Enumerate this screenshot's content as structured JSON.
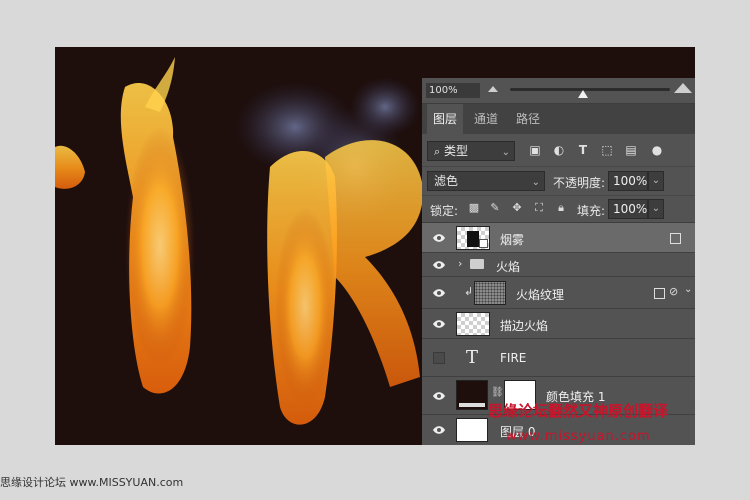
{
  "layers_panel": {
    "zoom": "100%",
    "tabs": [
      {
        "label": "图层",
        "active": true
      },
      {
        "label": "通道",
        "active": false
      },
      {
        "label": "路径",
        "active": false
      }
    ],
    "filter": {
      "label": "类型",
      "icons": [
        "image-filter-icon",
        "adjustment-filter-icon",
        "type-filter-icon",
        "shape-filter-icon",
        "smart-object-filter-icon",
        "filter-toggle-icon"
      ]
    },
    "blend_mode": "滤色",
    "opacity_label": "不透明度:",
    "opacity_value": "100%",
    "lock_label": "锁定:",
    "fill_label": "填充:",
    "fill_value": "100%",
    "layers": [
      {
        "name": "烟雾",
        "visible": true,
        "selected": true,
        "type": "smart-object"
      },
      {
        "name": "火焰",
        "visible": true,
        "selected": false,
        "type": "group"
      },
      {
        "name": "火焰纹理",
        "visible": true,
        "selected": false,
        "type": "clipped-smart-object"
      },
      {
        "name": "描边火焰",
        "visible": true,
        "selected": false,
        "type": "pixel"
      },
      {
        "name": "FIRE",
        "visible": false,
        "selected": false,
        "type": "text"
      },
      {
        "name": "颜色填充 1",
        "visible": true,
        "selected": false,
        "type": "fill"
      },
      {
        "name": "图层 0",
        "visible": true,
        "selected": false,
        "type": "pixel"
      }
    ]
  },
  "watermark": {
    "line1": "思缘论坛翻然又神原创翻译",
    "line2": "www.missyuan.com"
  },
  "footer": "思缘设计论坛 www.MISSYUAN.com",
  "colors": {
    "panel_bg": "#535353",
    "selected_row": "#6a6a6a",
    "canvas_bg": "#1e0f0d",
    "watermark": "#c8142a"
  }
}
